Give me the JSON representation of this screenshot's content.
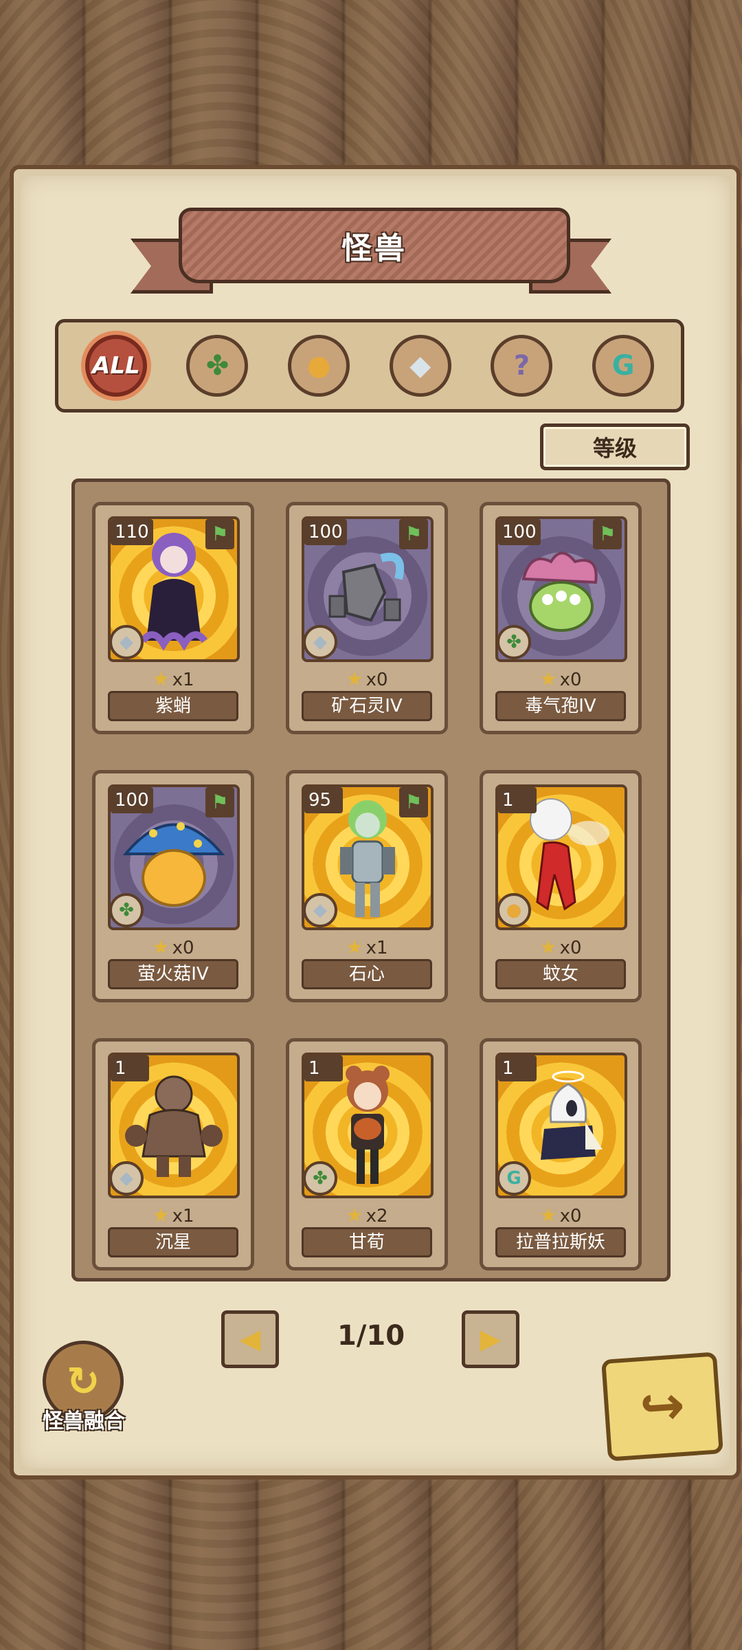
{
  "header": {
    "title": "怪兽"
  },
  "filters": [
    {
      "label": "ALL",
      "icon": "all-icon",
      "active": true
    },
    {
      "label": "",
      "icon": "leaf-icon"
    },
    {
      "label": "",
      "icon": "paw-icon"
    },
    {
      "label": "",
      "icon": "crystal-icon"
    },
    {
      "label": "",
      "icon": "question-icon"
    },
    {
      "label": "",
      "icon": "spiral-icon"
    }
  ],
  "sort": {
    "label": "等级"
  },
  "monsters": [
    {
      "name": "紫蛸",
      "level": "110",
      "count": "x1",
      "type": "crystal",
      "bg": "gold",
      "flag": true
    },
    {
      "name": "矿石灵IV",
      "level": "100",
      "count": "x0",
      "type": "crystal",
      "bg": "purple",
      "flag": true
    },
    {
      "name": "毒气孢IV",
      "level": "100",
      "count": "x0",
      "type": "leaf",
      "bg": "purple",
      "flag": true
    },
    {
      "name": "萤火菇IV",
      "level": "100",
      "count": "x0",
      "type": "leaf",
      "bg": "purple",
      "flag": true
    },
    {
      "name": "石心",
      "level": "95",
      "count": "x1",
      "type": "crystal",
      "bg": "gold",
      "flag": true
    },
    {
      "name": "蚊女",
      "level": "1",
      "count": "x0",
      "type": "paw",
      "bg": "gold",
      "flag": false
    },
    {
      "name": "沉星",
      "level": "1",
      "count": "x1",
      "type": "crystal",
      "bg": "gold",
      "flag": false
    },
    {
      "name": "甘荀",
      "level": "1",
      "count": "x2",
      "type": "leaf",
      "bg": "gold",
      "flag": false
    },
    {
      "name": "拉普拉斯妖",
      "level": "1",
      "count": "x0",
      "type": "spiral",
      "bg": "gold",
      "flag": false
    }
  ],
  "pagination": {
    "current": "1/10"
  },
  "fusion": {
    "label": "怪兽融合"
  },
  "colors": {
    "accent": "#b5503e",
    "parchment": "#ece0c3",
    "wood": "#7d5e40",
    "gold": "#e2b43a"
  }
}
